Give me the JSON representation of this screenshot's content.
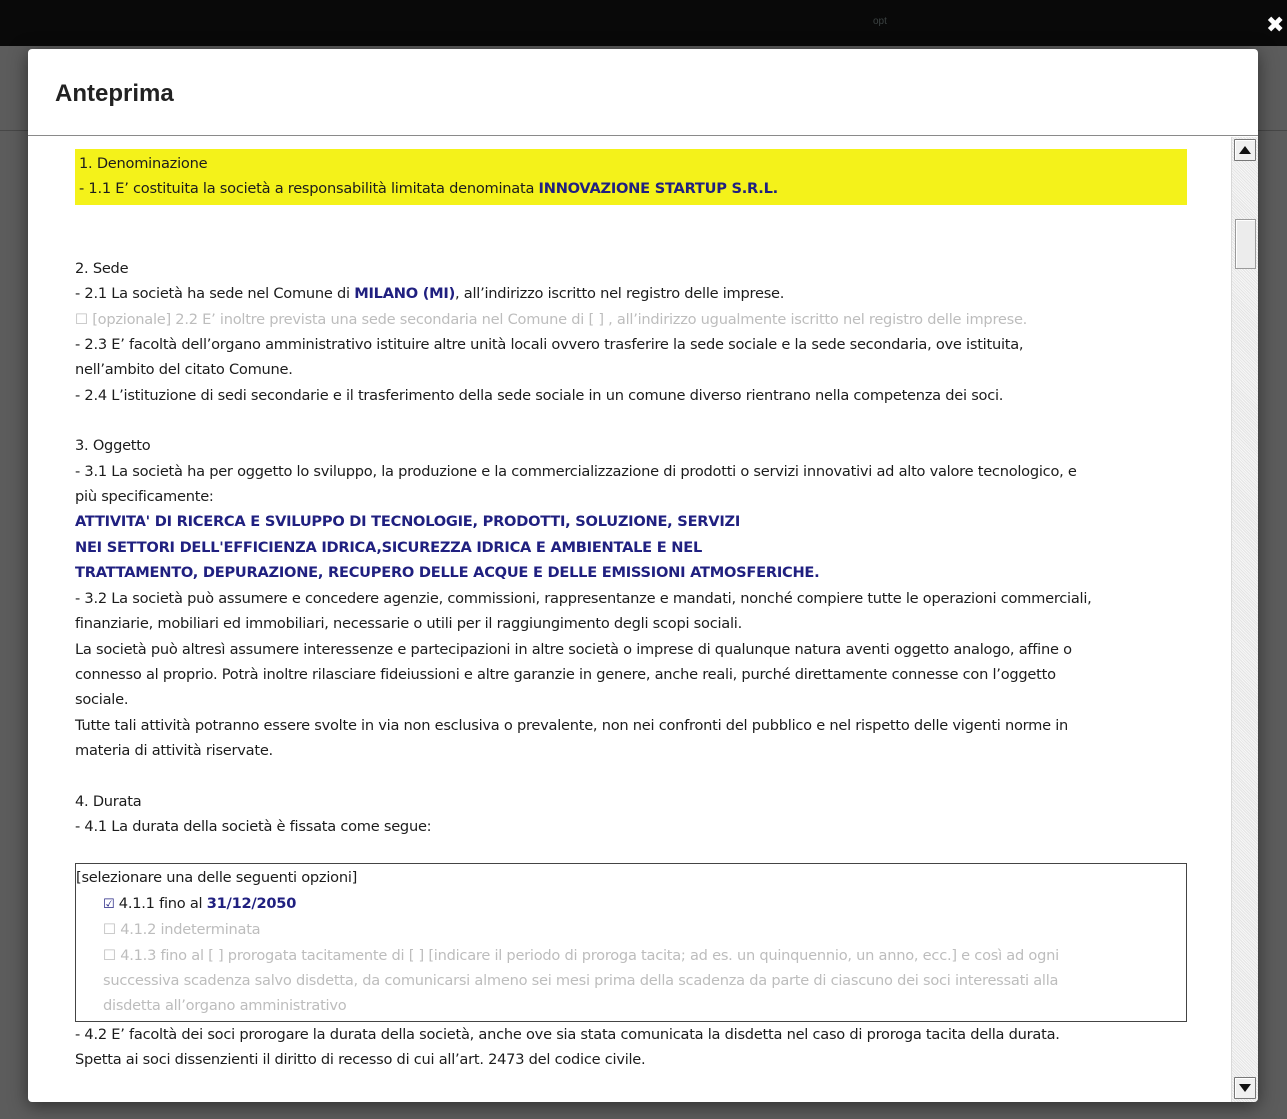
{
  "modal": {
    "title": "Anteprima"
  },
  "sections": {
    "s1": {
      "heading": "1. Denominazione",
      "p1_prefix": "- 1.1 E’ costituita la società a responsabilità limitata denominata ",
      "p1_value": "INNOVAZIONE STARTUP S.R.L."
    },
    "s2": {
      "heading": "2. Sede",
      "p1_prefix": "- 2.1 La società ha sede nel Comune di ",
      "p1_value": "MILANO (MI)",
      "p1_suffix": ", all’indirizzo iscritto nel registro delle imprese.",
      "p2_optional": "☐ [opzionale] 2.2 E’ inoltre prevista una sede secondaria nel Comune di [ ] , all’indirizzo ugualmente iscritto nel registro delle imprese.",
      "p3_l1": "- 2.3 E’ facoltà dell’organo amministrativo istituire altre unità locali ovvero trasferire la sede sociale e la sede secondaria, ove istituita,",
      "p3_l2": "nell’ambito del citato Comune.",
      "p4": "- 2.4 L’istituzione di sedi secondarie e il trasferimento della sede sociale in un comune diverso rientrano nella competenza dei soci."
    },
    "s3": {
      "heading": "3. Oggetto",
      "p1_l1": "- 3.1 La società ha per oggetto lo sviluppo, la produzione e la commercializzazione di prodotti o servizi innovativi ad alto valore tecnologico, e",
      "p1_l2": "più specificamente:",
      "obj_l1": "ATTIVITA' DI RICERCA E SVILUPPO DI TECNOLOGIE, PRODOTTI, SOLUZIONE, SERVIZI",
      "obj_l2": "NEI SETTORI DELL'EFFICIENZA IDRICA,SICUREZZA IDRICA E AMBIENTALE E NEL",
      "obj_l3": "TRATTAMENTO, DEPURAZIONE, RECUPERO DELLE ACQUE E DELLE EMISSIONI ATMOSFERICHE.",
      "p2_l1": "- 3.2 La società può assumere e concedere agenzie, commissioni, rappresentanze e mandati, nonché compiere tutte le operazioni commerciali,",
      "p2_l2": "finanziarie, mobiliari ed immobiliari, necessarie o utili per il raggiungimento degli scopi sociali.",
      "p3_l1": "La società può altresì assumere interessenze e partecipazioni in altre società o imprese di qualunque natura aventi oggetto analogo, affine o",
      "p3_l2": "connesso al proprio. Potrà inoltre rilasciare fideiussioni e altre garanzie in genere, anche reali, purché direttamente connesse con l’oggetto",
      "p3_l3": "sociale.",
      "p4_l1": "Tutte tali attività potranno essere svolte in via non esclusiva o prevalente, non nei confronti del pubblico e nel rispetto delle vigenti norme in",
      "p4_l2": "materia di attività riservate."
    },
    "s4": {
      "heading": "4. Durata",
      "p1": "- 4.1 La durata della società è fissata come segue:",
      "box_header": "[selezionare una delle seguenti opzioni]",
      "opt1_check": "☑",
      "opt1_prefix": " 4.1.1 fino al ",
      "opt1_value": "31/12/2050",
      "opt2": "☐ 4.1.2 indeterminata",
      "opt3_l1": "☐ 4.1.3 fino al [ ] prorogata tacitamente di [ ] [indicare il periodo di proroga tacita; ad es. un quinquennio, un anno, ecc.] e così ad ogni",
      "opt3_l2": "successiva scadenza salvo disdetta, da comunicarsi almeno sei mesi prima della scadenza da parte di ciascuno dei soci interessati alla",
      "opt3_l3": "disdetta all’organo amministrativo",
      "p2_l1": "- 4.2 E’ facoltà dei soci prorogare la durata della società, anche ove sia stata comunicata la disdetta nel caso di proroga tacita della durata.",
      "p2_l2": "Spetta ai soci dissenzienti il diritto di recesso di cui all’art. 2473 del codice civile."
    }
  },
  "colors": {
    "highlight": "#f4f21a",
    "value_blue": "#202080",
    "optional_grey": "#bdbdbd"
  }
}
